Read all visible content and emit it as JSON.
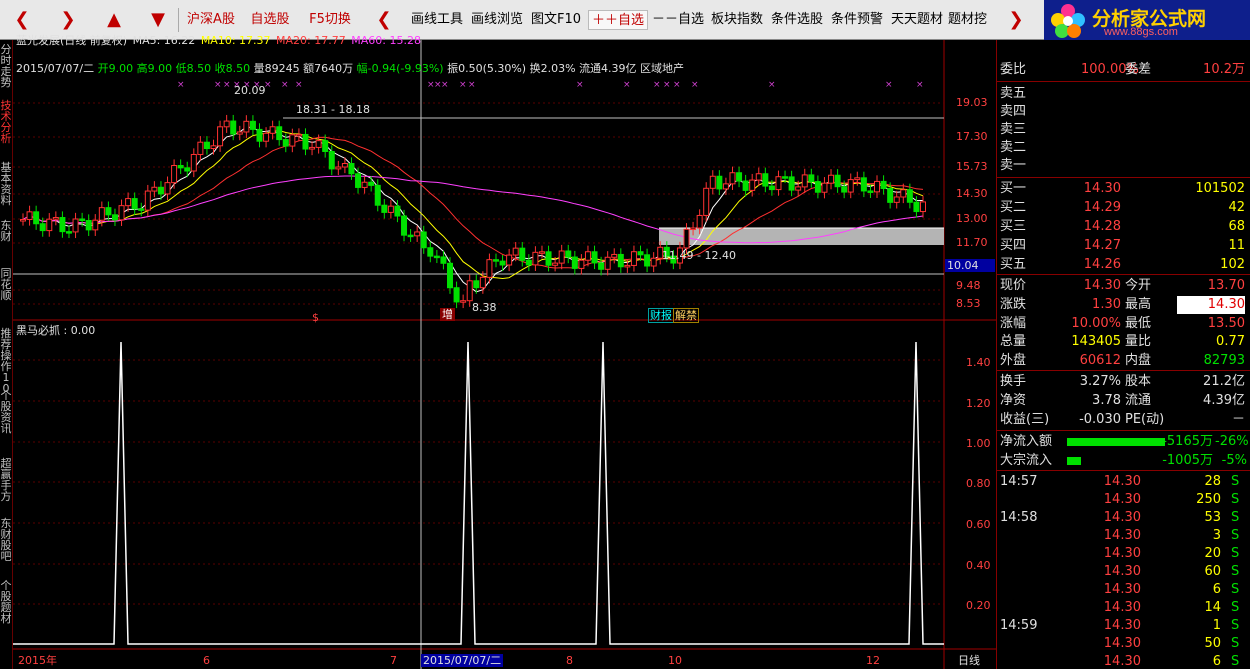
{
  "toolbar": {
    "nav": [
      "❮",
      "❯",
      "▲",
      "▼"
    ],
    "buttons": [
      "沪深A股",
      "自选股",
      "F5切换",
      "画线工具",
      "画线浏览",
      "图文F10",
      "＋＋自选",
      "－－自选",
      "板块指数",
      "条件选股",
      "条件预警",
      "天天题材",
      "题材挖"
    ],
    "back_arrow": "❮",
    "more_arrow": "❯",
    "logo_title": "分析家公式网",
    "logo_url": "www.88gs.com"
  },
  "left_tabs": [
    "分时走势",
    "技术分析",
    "基本资料",
    "东财",
    "同花顺",
    "推荐操作10",
    "个股资讯",
    "超赢手方",
    "东财股吧",
    "个股题材"
  ],
  "chart_header": {
    "name": "蓝光发展(日线 前复权)",
    "ma5": "MA5: 16.22",
    "ma10": "MA10: 17.37",
    "ma20": "MA20: 17.77",
    "ma60": "MA60: 15.28",
    "date": "2015/07/07/二",
    "open": "开9.00",
    "high": "高9.00",
    "low": "低8.50",
    "close": "收8.50",
    "volume": "量89245",
    "amount": "额7640万",
    "change": "幅-0.94(-9.93%)",
    "amplitude": "振0.50(5.30%)",
    "turnover": "换2.03%",
    "float": "流通4.39亿",
    "sector": "区域地产"
  },
  "annotations": {
    "peak": "20.09",
    "range_high": "18.31 - 18.18",
    "range_low": "11.49 - 12.40",
    "bottom": "8.38",
    "event_zeng": "增",
    "event_s": "$",
    "event_caibao": "财报",
    "event_zhengju": "解禁"
  },
  "price_axis": [
    "19.03",
    "17.30",
    "15.73",
    "14.30",
    "13.00",
    "11.70",
    "10.04",
    "9.48",
    "8.53"
  ],
  "indicator": {
    "title": "黑马必抓 : 0.00",
    "axis": [
      "1.40",
      "1.20",
      "1.00",
      "0.80",
      "0.60",
      "0.40",
      "0.20"
    ]
  },
  "date_axis": {
    "labels": [
      "2015年",
      "6",
      "7",
      "2015/07/07/二",
      "8",
      "10",
      "12"
    ],
    "period": "日线"
  },
  "colors": {
    "up": "#ff3232",
    "down": "#00e000",
    "ma5": "#ffffff",
    "ma10": "#ffff00",
    "ma20": "#ff3030",
    "ma60": "#ff40ff"
  },
  "order_book": {
    "weibi_label": "委比",
    "weibi_value": "100.00%",
    "weicha_label": "委差",
    "weicha_value": "10.2万",
    "asks": [
      {
        "label": "卖五",
        "price": "",
        "vol": ""
      },
      {
        "label": "卖四",
        "price": "",
        "vol": ""
      },
      {
        "label": "卖三",
        "price": "",
        "vol": ""
      },
      {
        "label": "卖二",
        "price": "",
        "vol": ""
      },
      {
        "label": "卖一",
        "price": "",
        "vol": ""
      }
    ],
    "bids": [
      {
        "label": "买一",
        "price": "14.30",
        "vol": "101502"
      },
      {
        "label": "买二",
        "price": "14.29",
        "vol": "42"
      },
      {
        "label": "买三",
        "price": "14.28",
        "vol": "68"
      },
      {
        "label": "买四",
        "price": "14.27",
        "vol": "11"
      },
      {
        "label": "买五",
        "price": "14.26",
        "vol": "102"
      }
    ]
  },
  "quote": [
    {
      "l1": "现价",
      "v1": "14.30",
      "l2": "今开",
      "v2": "13.70"
    },
    {
      "l1": "涨跌",
      "v1": "1.30",
      "l2": "最高",
      "v2": "14.30"
    },
    {
      "l1": "涨幅",
      "v1": "10.00%",
      "l2": "最低",
      "v2": "13.50"
    },
    {
      "l1": "总量",
      "v1": "143405",
      "l2": "量比",
      "v2": "0.77"
    },
    {
      "l1": "外盘",
      "v1": "60612",
      "l2": "内盘",
      "v2": "82793"
    }
  ],
  "stats": [
    {
      "l1": "换手",
      "v1": "3.27%",
      "l2": "股本",
      "v2": "21.2亿"
    },
    {
      "l1": "净资",
      "v1": "3.78",
      "l2": "流通",
      "v2": "4.39亿"
    },
    {
      "l1": "收益(三)",
      "v1": "-0.030",
      "l2": "PE(动)",
      "v2": "－"
    }
  ],
  "flows": [
    {
      "label": "净流入额",
      "value": "-5165万",
      "pct": "-26%"
    },
    {
      "label": "大宗流入",
      "value": "-1005万",
      "pct": "-5%"
    }
  ],
  "ticks": [
    {
      "time": "14:57",
      "price": "14.30",
      "vol": "28",
      "side": "S"
    },
    {
      "time": "",
      "price": "14.30",
      "vol": "250",
      "side": "S"
    },
    {
      "time": "14:58",
      "price": "14.30",
      "vol": "53",
      "side": "S"
    },
    {
      "time": "",
      "price": "14.30",
      "vol": "3",
      "side": "S"
    },
    {
      "time": "",
      "price": "14.30",
      "vol": "20",
      "side": "S"
    },
    {
      "time": "",
      "price": "14.30",
      "vol": "60",
      "side": "S"
    },
    {
      "time": "",
      "price": "14.30",
      "vol": "6",
      "side": "S"
    },
    {
      "time": "",
      "price": "14.30",
      "vol": "14",
      "side": "S"
    },
    {
      "time": "14:59",
      "price": "14.30",
      "vol": "1",
      "side": "S"
    },
    {
      "time": "",
      "price": "14.30",
      "vol": "50",
      "side": "S"
    },
    {
      "time": "",
      "price": "14.30",
      "vol": "6",
      "side": "S"
    }
  ]
}
